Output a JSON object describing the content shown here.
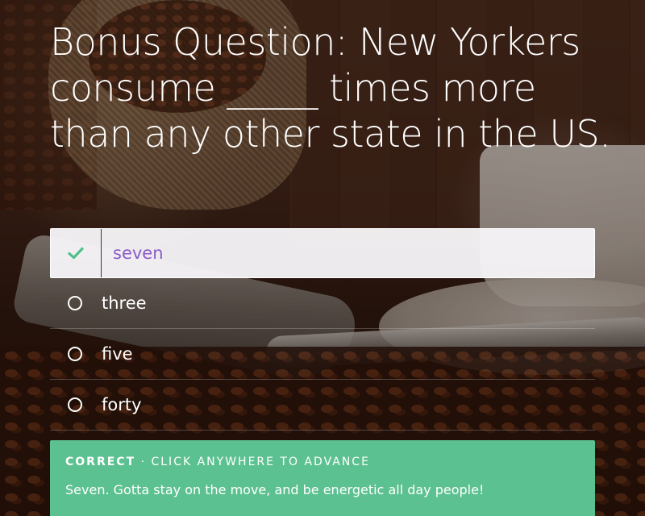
{
  "question": {
    "text": "Bonus Question: New Yorkers consume _____ times more than any other state in the US."
  },
  "answers": [
    {
      "label": "seven",
      "selected": true,
      "icon": "check-icon"
    },
    {
      "label": "three",
      "selected": false,
      "icon": "radio-icon"
    },
    {
      "label": "five",
      "selected": false,
      "icon": "radio-icon"
    },
    {
      "label": "forty",
      "selected": false,
      "icon": "radio-icon"
    }
  ],
  "feedback": {
    "status": "CORRECT",
    "separator": " · ",
    "instruction": "CLICK ANYWHERE TO ADVANCE",
    "message": "Seven. Gotta stay on the move, and be energetic all day people!"
  },
  "colors": {
    "correct_banner": "#5cc190",
    "check_mark": "#4fbf8a",
    "selected_text": "#8a5bc9",
    "text": "#ffffff"
  }
}
